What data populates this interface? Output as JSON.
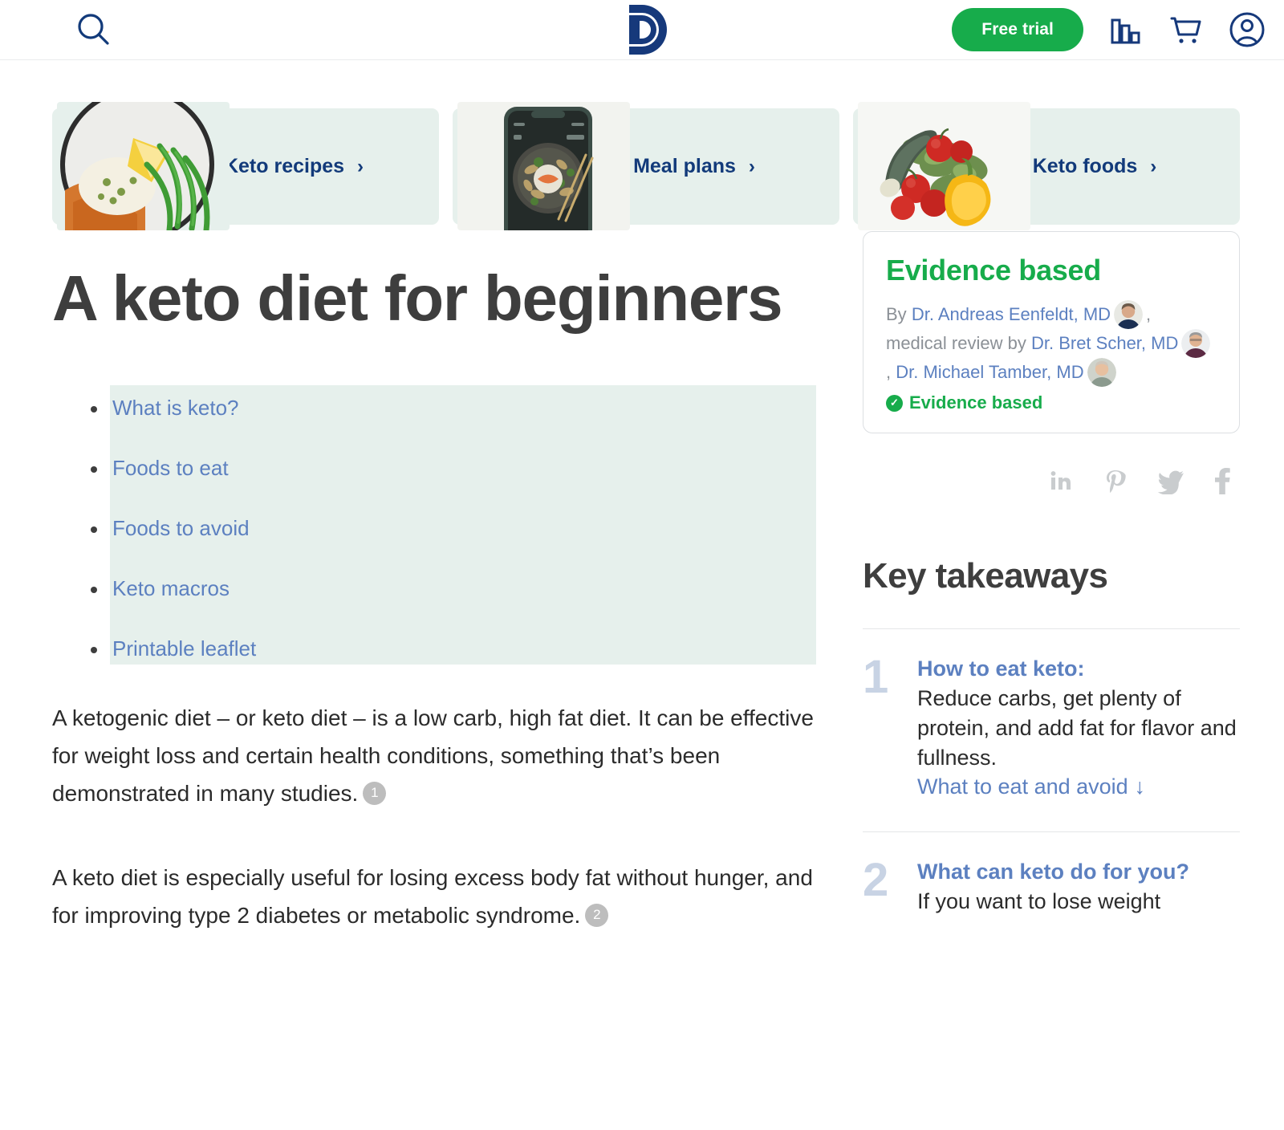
{
  "header": {
    "menu_icon": "hamburger-menu-icon",
    "search_icon": "search-icon",
    "logo_alt": "D",
    "free_trial_label": "Free trial",
    "progress_icon": "bar-chart-icon",
    "cart_icon": "shopping-cart-icon",
    "account_icon": "user-account-icon"
  },
  "nav_cards": [
    {
      "label": "Keto recipes",
      "chevron": "›",
      "image": "plate-of-fish-and-green-beans"
    },
    {
      "label": "Meal plans",
      "chevron": "›",
      "image": "phone-showing-stir-fry-bowl"
    },
    {
      "label": "Keto foods",
      "chevron": "›",
      "image": "zucchini-tomatoes-pepper-greens"
    }
  ],
  "article": {
    "title": "A keto diet for beginners",
    "toc": [
      {
        "label": "What is keto?"
      },
      {
        "label": "Foods to eat"
      },
      {
        "label": "Foods to avoid"
      },
      {
        "label": "Keto macros"
      },
      {
        "label": "Printable leaflet"
      }
    ],
    "paragraphs": [
      {
        "text": "A ketogenic diet – or keto diet – is a low carb, high fat diet. It can be effective for weight loss and certain health conditions, something that’s been demonstrated in many studies.",
        "ref": "1"
      },
      {
        "text": "A keto diet is especially useful for losing excess body fat without hunger, and for improving type 2 diabetes or metabolic syndrome.",
        "ref": "2"
      }
    ]
  },
  "evidence": {
    "title": "Evidence based",
    "by_prefix": "By",
    "author": "Dr. Andreas Eenfeldt, MD",
    "comma": ",",
    "review_prefix": "medical review by",
    "reviewer_1": "Dr. Bret Scher, MD",
    "reviewer_2": "Dr. Michael Tamber, MD",
    "badge_label": "Evidence based",
    "badge_icon": "check-circle-icon",
    "accent_green": "#17ac4b",
    "link_blue": "#5c80c0"
  },
  "socials": [
    {
      "name": "linkedin",
      "glyph": "in"
    },
    {
      "name": "pinterest",
      "glyph": "Ⓟ"
    },
    {
      "name": "twitter",
      "glyph": "ᵗ"
    },
    {
      "name": "facebook",
      "glyph": "f"
    }
  ],
  "key_takeaways": {
    "title": "Key takeaways",
    "items": [
      {
        "number": "1",
        "heading": "How to eat keto:",
        "text": "Reduce carbs, get plenty of protein, and add fat for flavor and fullness.",
        "link": "What to eat and avoid",
        "link_arrow": "↓"
      },
      {
        "number": "2",
        "heading": "What can keto do for you?",
        "text": "If you want to lose weight",
        "link": "",
        "link_arrow": ""
      }
    ]
  },
  "colors": {
    "brand_navy": "#123a7a",
    "green": "#17ac4b",
    "mint_bg": "#e6f0ec",
    "link": "#5c80c0",
    "text": "#2b2b2b"
  }
}
